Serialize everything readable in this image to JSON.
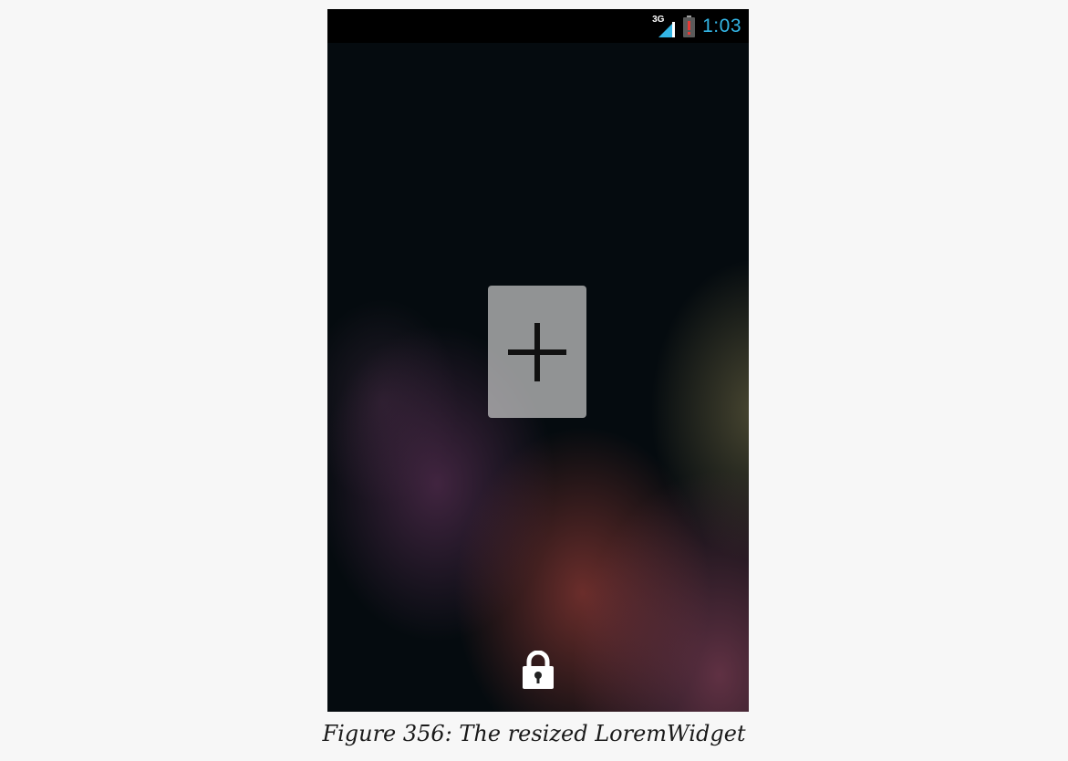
{
  "status_bar": {
    "network_type": "3G",
    "time": "1:03",
    "time_color": "#33b5e5",
    "signal_icon": "signal-bars-icon",
    "battery_icon": "battery-alert-icon"
  },
  "lockscreen": {
    "add_widget_icon": "plus-icon",
    "unlock_icon": "padlock-icon"
  },
  "caption": {
    "text": "Figure 356: The resized LoremWidget"
  }
}
